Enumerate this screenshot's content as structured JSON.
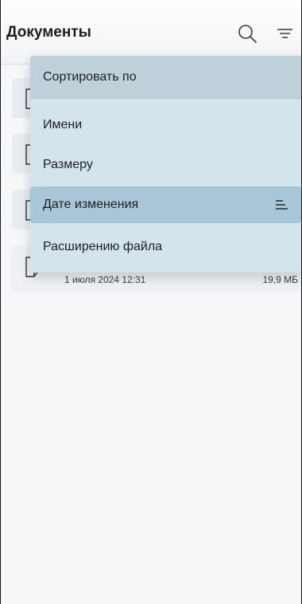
{
  "header": {
    "title": "Документы",
    "search_icon": "search-icon",
    "sort_icon": "sort-filter-icon"
  },
  "files": [
    {
      "date": "",
      "size": ""
    },
    {
      "date": "",
      "size": ""
    },
    {
      "date": "",
      "size": ""
    },
    {
      "date": "1 июля 2024 12:31",
      "size": "19,9 МБ"
    }
  ],
  "sort_menu": {
    "title": "Сортировать по",
    "options": [
      {
        "label": "Имени"
      },
      {
        "label": "Размеру"
      },
      {
        "label": "Дате изменения",
        "selected": true
      },
      {
        "label": "Расширению файла"
      }
    ]
  },
  "colors": {
    "menu_bg": "#d3e4ec",
    "menu_header_bg": "#bfd2dc",
    "selected_bg": "#a9c6d8"
  }
}
